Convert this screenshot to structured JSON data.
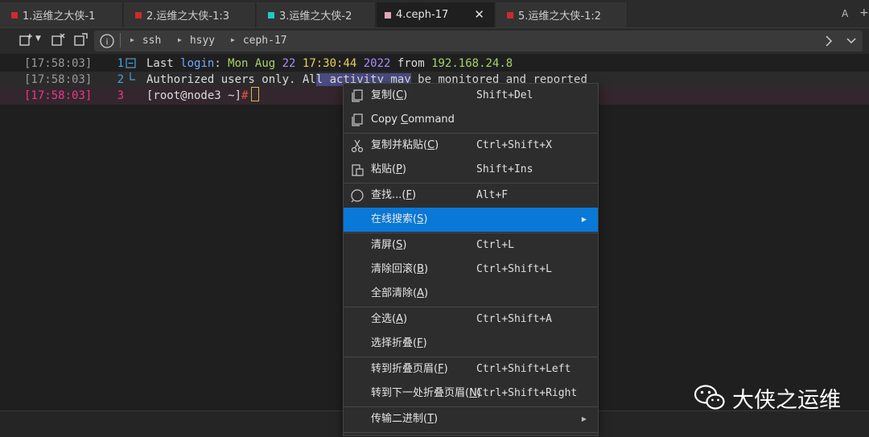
{
  "tabs": [
    {
      "label": "1.运维之大侠-1",
      "color": "#cc2b2b"
    },
    {
      "label": "2.运维之大侠-1:3",
      "color": "#cc2b2b"
    },
    {
      "label": "3.运维之大侠-2",
      "color": "#1fc8c8"
    },
    {
      "label": "4.ceph-17",
      "color": "#e3a6b4",
      "active": true
    },
    {
      "label": "5.运维之大侠-1:2",
      "color": "#cc2b2b"
    }
  ],
  "tabbar_right": {
    "a_label": "A",
    "plus_label": "+"
  },
  "breadcrumb": [
    "ssh",
    "hsyy",
    "ceph-17"
  ],
  "terminal": {
    "lines": [
      {
        "ts": "[17:58:03]",
        "num": "1",
        "seg": [
          "Last ",
          "login",
          ": ",
          "Mon Aug ",
          "22",
          " 17:30:44",
          " 2022",
          " from ",
          "192.168.24.8"
        ]
      },
      {
        "ts": "[17:58:03]",
        "num": "2",
        "seg": [
          "Authorized users only. Al",
          "l activity may",
          " be monitored and reported"
        ]
      },
      {
        "ts": "[17:58:03]",
        "num": "3",
        "seg": [
          "[root@node3 ~]",
          "#"
        ]
      }
    ]
  },
  "menu": {
    "items": [
      {
        "label": "复制(",
        "key": "C",
        "tail": ")",
        "shortcut": "Shift+Del",
        "icon": "copy-icon"
      },
      {
        "label": "Copy ",
        "key": "C",
        "tail": "ommand",
        "shortcut": "",
        "icon": "copy-icon"
      },
      {
        "label": "复制并粘贴(",
        "key": "C",
        "tail": ")",
        "shortcut": "Ctrl+Shift+X",
        "icon": "scissors-icon"
      },
      {
        "label": "粘贴(",
        "key": "P",
        "tail": ")",
        "shortcut": "Shift+Ins",
        "icon": "paste-icon"
      },
      {
        "label": "查找...(",
        "key": "F",
        "tail": ")",
        "shortcut": "Alt+F",
        "icon": "find-icon"
      },
      {
        "label": "在线搜索(",
        "key": "S",
        "tail": ")",
        "shortcut": "",
        "icon": ""
      },
      {
        "label": "清屏(",
        "key": "S",
        "tail": ")",
        "shortcut": "Ctrl+L",
        "icon": ""
      },
      {
        "label": "清除回滚(",
        "key": "B",
        "tail": ")",
        "shortcut": "Ctrl+Shift+L",
        "icon": ""
      },
      {
        "label": "全部清除(",
        "key": "A",
        "tail": ")",
        "shortcut": "",
        "icon": ""
      },
      {
        "label": "全选(",
        "key": "A",
        "tail": ")",
        "shortcut": "Ctrl+Shift+A",
        "icon": ""
      },
      {
        "label": "选择折叠(",
        "key": "F",
        "tail": ")",
        "shortcut": "",
        "icon": ""
      },
      {
        "label": "转到折叠页眉(",
        "key": "F",
        "tail": ")",
        "shortcut": "Ctrl+Shift+Left",
        "icon": ""
      },
      {
        "label": "转到下一处折叠页眉(",
        "key": "N",
        "tail": ")",
        "shortcut": "Ctrl+Shift+Right",
        "icon": ""
      },
      {
        "label": "传输二进制(",
        "key": "T",
        "tail": ")",
        "shortcut": "",
        "icon": ""
      }
    ]
  },
  "watermark": "大侠之运维",
  "colors": {
    "accent": "#0a78d7",
    "selection": "#4a4a80",
    "line_number": "#4ea0d8",
    "prompt_line": "#e83a8a"
  }
}
